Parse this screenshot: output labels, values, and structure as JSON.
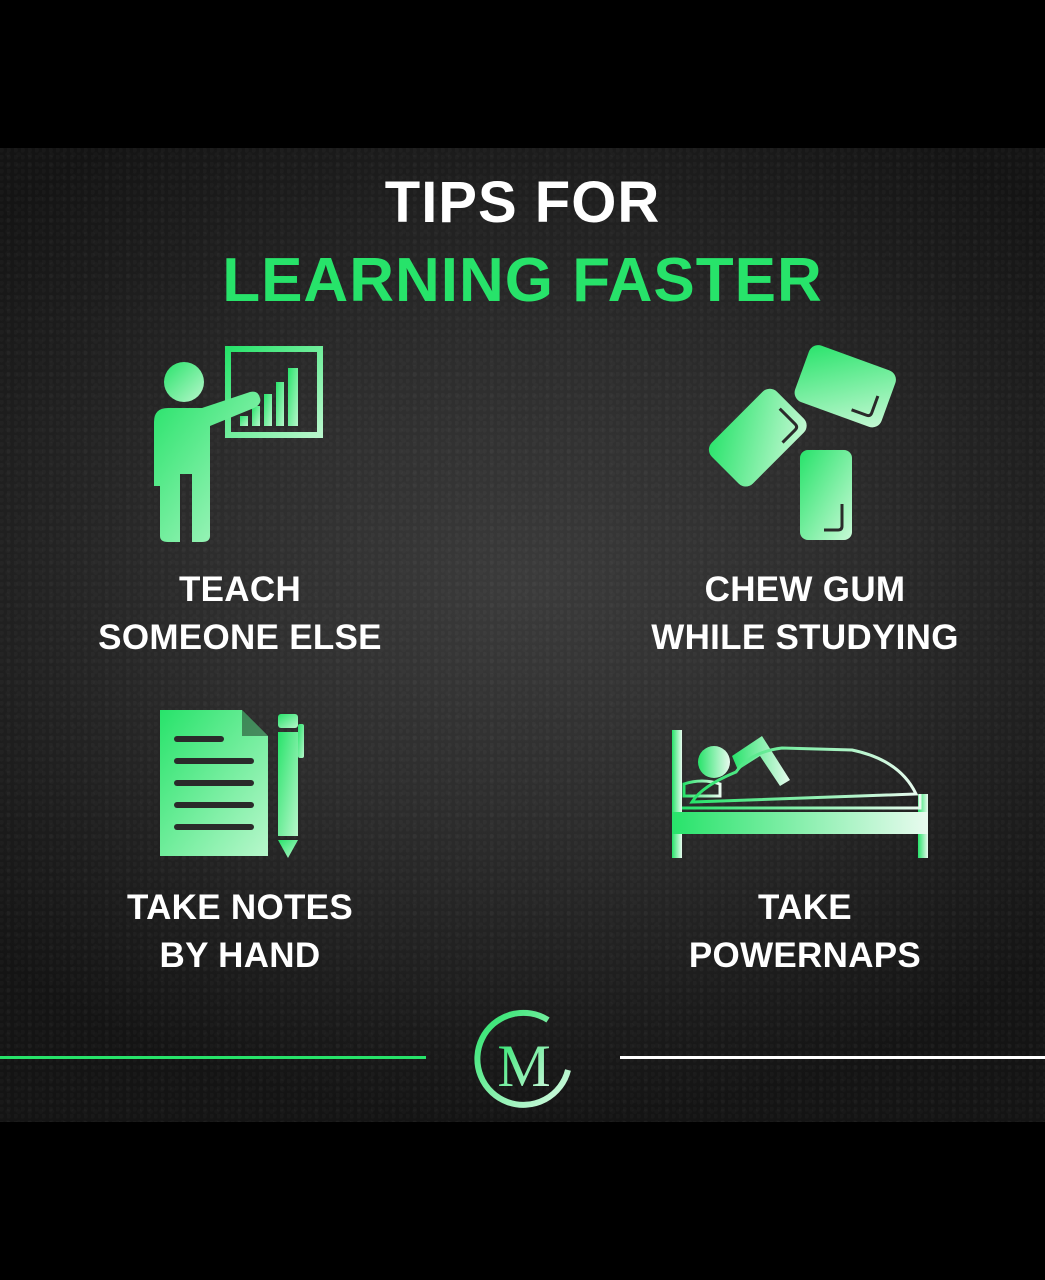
{
  "title": {
    "line1": "TIPS FOR",
    "line2": "LEARNING FASTER"
  },
  "tips": [
    {
      "icon": "teacher-presentation-icon",
      "line1": "TEACH",
      "line2": "SOMEONE ELSE"
    },
    {
      "icon": "chewing-gum-icon",
      "line1": "CHEW GUM",
      "line2": "WHILE STUDYING"
    },
    {
      "icon": "notes-pen-icon",
      "line1": "TAKE NOTES",
      "line2": "BY HAND"
    },
    {
      "icon": "sleeping-bed-icon",
      "line1": "TAKE",
      "line2": "POWERNAPS"
    }
  ],
  "logo": {
    "icon": "m-brand-logo",
    "letter": "M"
  },
  "colors": {
    "accent": "#27e36a",
    "accent_light": "#b8f7cc",
    "text": "#ffffff",
    "background": "#2a2a2a",
    "outer": "#000000"
  }
}
